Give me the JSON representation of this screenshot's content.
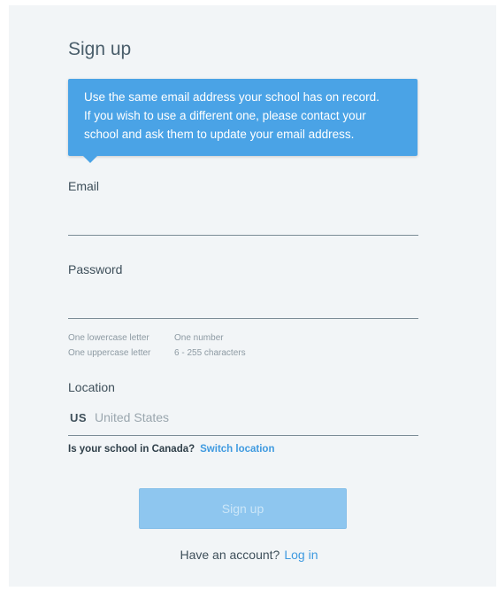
{
  "form": {
    "title": "Sign up",
    "notice": {
      "line1": "Use the same email address your school has on record.",
      "line2": "If you wish to use a different one, please contact your",
      "line3": "school and ask them to update your email address."
    },
    "email": {
      "label": "Email",
      "value": ""
    },
    "password": {
      "label": "Password",
      "value": "",
      "requirements": [
        "One lowercase letter",
        "One number",
        "One uppercase letter",
        "6 - 255 characters"
      ]
    },
    "location": {
      "label": "Location",
      "country_code": "US",
      "country_name": "United States",
      "canada_prompt": "Is your school in Canada?",
      "switch_label": "Switch location"
    },
    "submit_label": "Sign up",
    "login_prompt": "Have an account?",
    "login_label": "Log in"
  },
  "colors": {
    "accent": "#4aa3e6",
    "link": "#3f9ae0",
    "button_disabled": "#8ec6ef",
    "background": "#f2f5f7"
  }
}
